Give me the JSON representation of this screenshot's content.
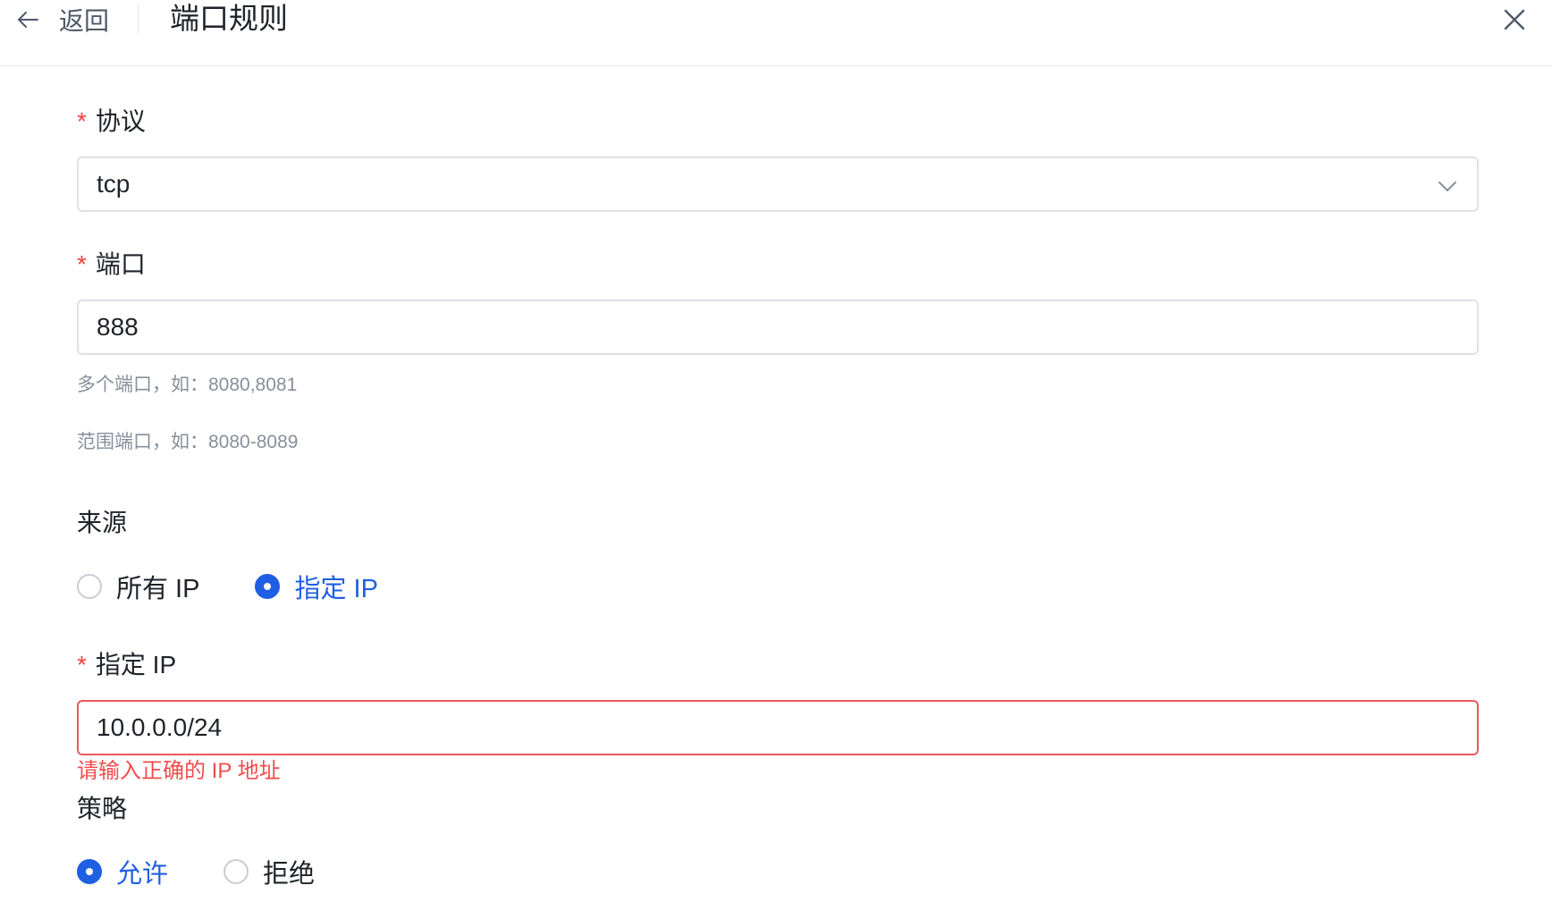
{
  "header": {
    "back_label": "返回",
    "title": "端口规则"
  },
  "form": {
    "protocol": {
      "required_mark": "*",
      "label": "协议",
      "value": "tcp"
    },
    "port": {
      "required_mark": "*",
      "label": "端口",
      "value": "888",
      "hint_multi": "多个端口，如：8080,8081",
      "hint_range": "范围端口，如：8080-8089"
    },
    "source": {
      "label": "来源",
      "options": [
        {
          "label": "所有 IP",
          "checked": false
        },
        {
          "label": "指定 IP",
          "checked": true
        }
      ]
    },
    "specified_ip": {
      "required_mark": "*",
      "label": "指定 IP",
      "value": "10.0.0.0/24",
      "error": "请输入正确的 IP 地址"
    },
    "policy": {
      "label": "策略",
      "options": [
        {
          "label": "允许",
          "checked": true
        },
        {
          "label": "拒绝",
          "checked": false
        }
      ]
    }
  },
  "colors": {
    "primary": "#1f5fe3",
    "error": "#f04c4c",
    "hint": "#86909c",
    "border": "#dfe1e6"
  },
  "icons": {
    "back": "arrow-left-icon",
    "close": "close-icon",
    "select": "chevron-down-icon"
  }
}
